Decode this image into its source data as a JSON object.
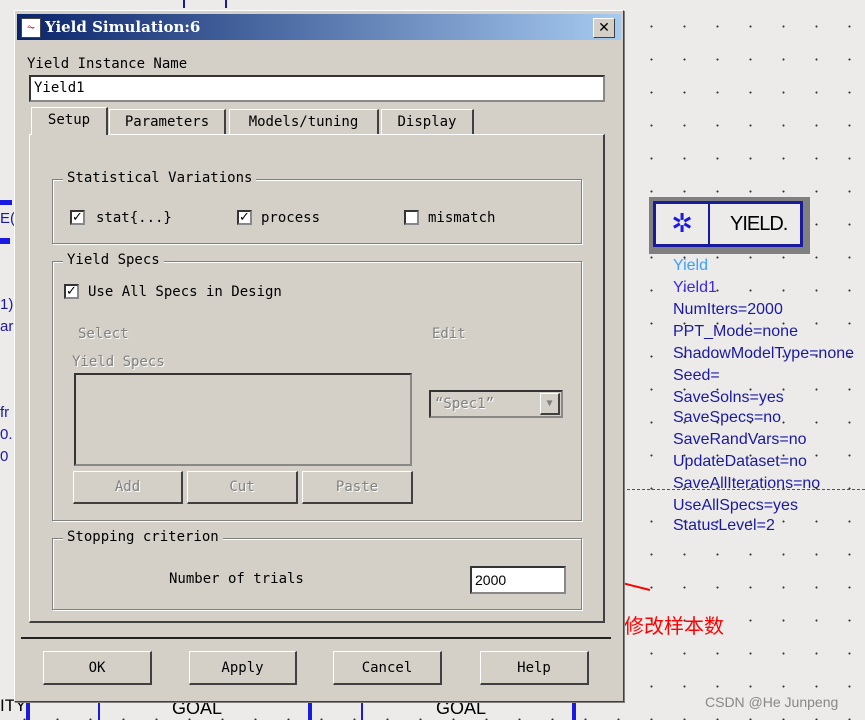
{
  "dialog": {
    "title": "Yield Simulation:6",
    "instance_label": "Yield Instance Name",
    "instance_value": "Yield1",
    "tabs": [
      {
        "label": "Setup",
        "active": true
      },
      {
        "label": "Parameters"
      },
      {
        "label": "Models/tuning"
      },
      {
        "label": "Display"
      }
    ],
    "statistical": {
      "title": "Statistical Variations",
      "items": [
        {
          "label": "stat{...}",
          "checked": true
        },
        {
          "label": "process",
          "checked": true
        },
        {
          "label": "mismatch",
          "checked": false
        }
      ]
    },
    "yield_specs": {
      "title": "Yield Specs",
      "use_all_label": "Use All Specs in Design",
      "use_all_checked": true,
      "select_label": "Select",
      "edit_label": "Edit",
      "list_label": "Yield Specs",
      "add_label": "Add",
      "cut_label": "Cut",
      "paste_label": "Paste",
      "spec_dropdown": "“Spec1”"
    },
    "stopping": {
      "title": "Stopping criterion",
      "trials_label": "Number of trials",
      "trials_value": "2000"
    },
    "buttons": {
      "ok": "OK",
      "apply": "Apply",
      "cancel": "Cancel",
      "help": "Help"
    }
  },
  "schematic": {
    "component_label": "YIELD.",
    "props": [
      "Yield",
      "Yield1",
      "NumIters=2000",
      "PPT_Mode=none",
      "ShadowModelType=none",
      "Seed=",
      "SaveSolns=yes",
      "SaveSpecs=no",
      "SaveRandVars=no",
      "UpdateDataset=no",
      "SaveAllIterations=no",
      "UseAllSpecs=yes",
      "StatusLevel=2"
    ],
    "goal_labels": [
      "GOAL",
      "GOAL"
    ],
    "left_fragments": [
      "E(",
      "1)",
      "ar",
      "fr",
      "0.",
      "0",
      "ITY"
    ]
  },
  "annotation": {
    "text": "修改样本数",
    "color": "#ff0000"
  },
  "watermark": "CSDN @He Junpeng",
  "colors": {
    "titlebar_start": "#0a246a",
    "titlebar_end": "#a6caf0",
    "dialog_bg": "#d4d0c8",
    "wire": "#1a1aa0"
  }
}
